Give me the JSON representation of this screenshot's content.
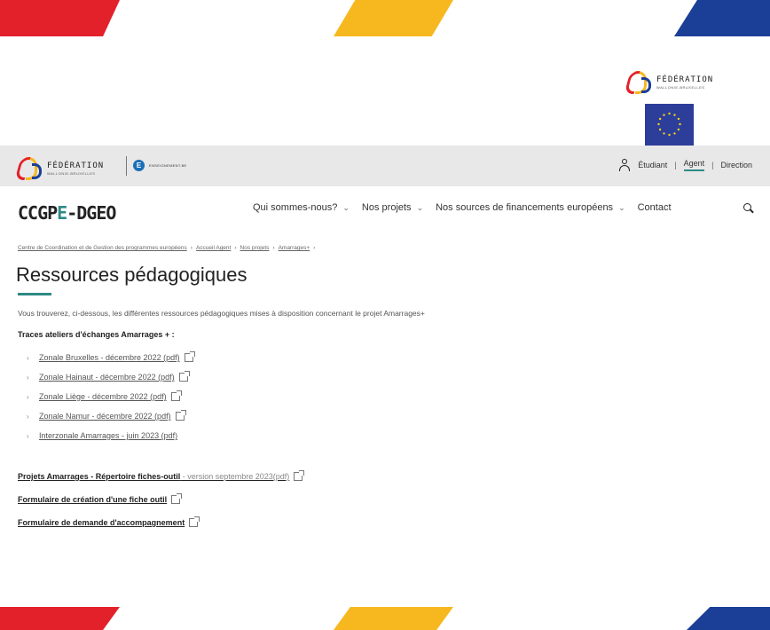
{
  "header": {
    "federation_title": "FÉDÉRATION",
    "federation_subtitle": "WALLONIE-BRUXELLES",
    "enseignement_label": "ENSEIGNEMENT.BE",
    "enseignement_initial": "E",
    "user_links": [
      "Étudiant",
      "Agent",
      "Direction"
    ],
    "active_user_link": "Agent"
  },
  "nav": {
    "brand_prefix": "CCGP",
    "brand_highlight": "E",
    "brand_suffix": "-DGEO",
    "items": [
      {
        "label": "Qui sommes-nous?",
        "has_dropdown": true
      },
      {
        "label": "Nos projets",
        "has_dropdown": true
      },
      {
        "label": "Nos sources de financements européens",
        "has_dropdown": true
      },
      {
        "label": "Contact",
        "has_dropdown": false
      }
    ],
    "search_icon": "search-icon"
  },
  "breadcrumb": [
    "Centre de Coordination et de Gestion des programmes européens",
    "Accueil Agent",
    "Nos projets",
    "Amarrages+"
  ],
  "page": {
    "title": "Ressources pédagogiques",
    "intro": "Vous trouverez, ci-dessous, les différentes ressources pédagogiques mises à disposition concernant le projet Amarrages+",
    "section_heading": "Traces ateliers d'échanges Amarrages + :",
    "list": [
      {
        "label": "Zonale Bruxelles - décembre 2022 (pdf)",
        "external": true
      },
      {
        "label": "Zonale Hainaut - décembre 2022 (pdf)",
        "external": true
      },
      {
        "label": "Zonale Liège - décembre 2022 (pdf)",
        "external": true
      },
      {
        "label": "Zonale Namur - décembre 2022 (pdf)",
        "external": true
      },
      {
        "label": "Interzonale Amarrages - juin 2023 (pdf)",
        "external": false
      }
    ],
    "repertoire_bold": "Projets Amarrages - Répertoire fiches-outil",
    "repertoire_light": " - version septembre 2023(pdf)",
    "formulaire_fiche": "Formulaire de création d'une fiche outil",
    "formulaire_accompagnement": "Formulaire de demande d'accompagnement"
  },
  "colors": {
    "red": "#e3212b",
    "yellow": "#f7b81f",
    "blue": "#1b3f97",
    "teal_accent": "#2d8a84"
  }
}
